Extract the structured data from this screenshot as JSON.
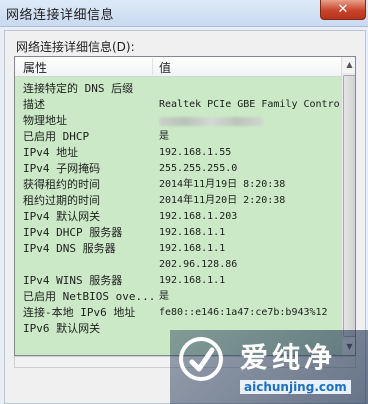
{
  "window": {
    "title": "网络连接详细信息",
    "close_label": "✕"
  },
  "details_label": "网络连接详细信息(D):",
  "columns": {
    "property": "属性",
    "value": "值"
  },
  "rows": [
    {
      "property": "连接特定的 DNS 后缀",
      "value": ""
    },
    {
      "property": "描述",
      "value": "Realtek PCIe GBE Family Contro"
    },
    {
      "property": "物理地址",
      "value": ""
    },
    {
      "property": "已启用 DHCP",
      "value": "是"
    },
    {
      "property": "IPv4 地址",
      "value": "192.168.1.55"
    },
    {
      "property": "IPv4 子网掩码",
      "value": "255.255.255.0"
    },
    {
      "property": "获得租约的时间",
      "value": "2014年11月19日 8:20:38"
    },
    {
      "property": "租约过期的时间",
      "value": "2014年11月20日 2:20:38"
    },
    {
      "property": "IPv4 默认网关",
      "value": "192.168.1.203"
    },
    {
      "property": "IPv4 DHCP 服务器",
      "value": "192.168.1.1"
    },
    {
      "property": "IPv4 DNS 服务器",
      "value": "192.168.1.1"
    },
    {
      "property": "",
      "value": "202.96.128.86"
    },
    {
      "property": "IPv4 WINS 服务器",
      "value": "192.168.1.1"
    },
    {
      "property": "已启用 NetBIOS ove...",
      "value": "是"
    },
    {
      "property": "连接-本地 IPv6 地址",
      "value": "fe80::e146:1a47:ce7b:b943%12"
    },
    {
      "property": "IPv6 默认网关",
      "value": ""
    }
  ],
  "watermark": {
    "name": "爱纯净",
    "url": "aichunjing.com"
  },
  "colors": {
    "row_highlight": "#cbe9c7",
    "title_bar": "#c9daf0",
    "close_button": "#c8452b"
  },
  "icons": {
    "close": "close-icon",
    "scroll_up": "chevron-up-icon",
    "scroll_down": "chevron-down-icon"
  }
}
